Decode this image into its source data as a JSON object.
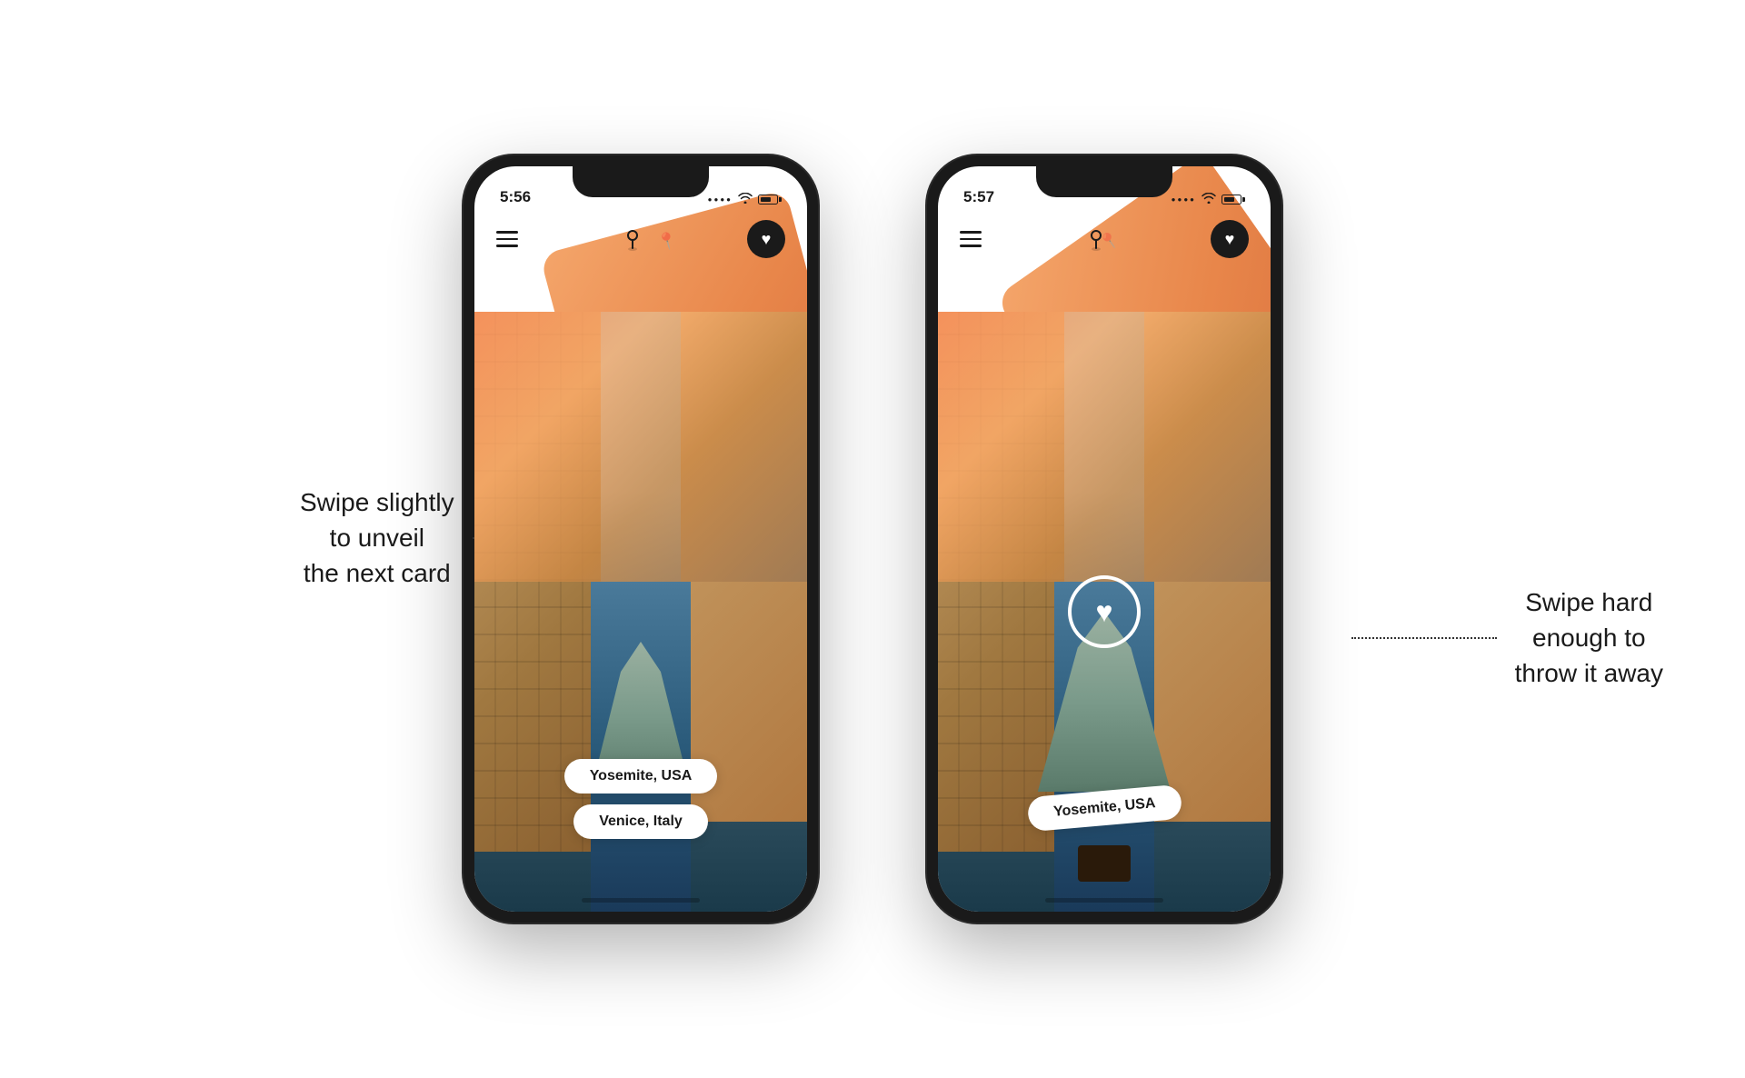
{
  "page": {
    "background": "#ffffff"
  },
  "annotation_left": {
    "line1": "Swipe slightly",
    "line2": "to unveil",
    "line3": "the next card"
  },
  "annotation_right": {
    "line1": "Swipe hard",
    "line2": "enough to",
    "line3": "throw it away"
  },
  "phone1": {
    "status_time": "5:56",
    "locations": [
      "Yosemite, USA",
      "Venice, Italy"
    ]
  },
  "phone2": {
    "status_time": "5:57",
    "locations": [
      "Yosemite, USA"
    ]
  },
  "icons": {
    "hamburger": "≡",
    "heart": "♥",
    "pin": "📍"
  }
}
